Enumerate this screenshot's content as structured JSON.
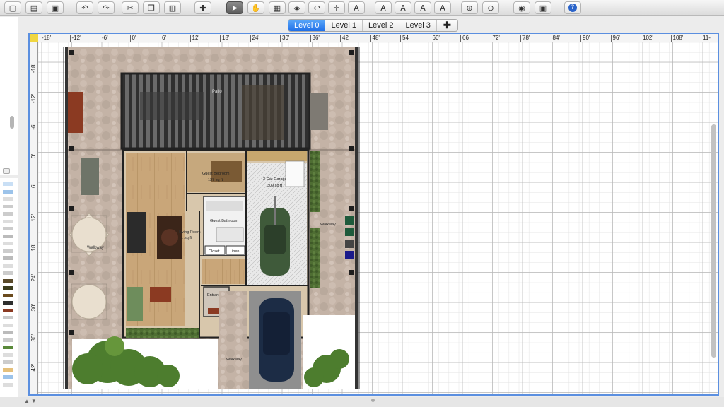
{
  "toolbar": {
    "buttons": [
      {
        "name": "new-home-button",
        "glyph": "▢"
      },
      {
        "name": "open-button",
        "glyph": "▤"
      },
      {
        "name": "save-button",
        "glyph": "▣"
      },
      {
        "name": "undo-button",
        "glyph": "↶"
      },
      {
        "name": "redo-button",
        "glyph": "↷"
      },
      {
        "name": "cut-button",
        "glyph": "✂"
      },
      {
        "name": "copy-button",
        "glyph": "❐"
      },
      {
        "name": "paste-button",
        "glyph": "▥"
      },
      {
        "name": "add-furniture-button",
        "glyph": "✚"
      },
      {
        "name": "select-mode-button",
        "glyph": "➤"
      },
      {
        "name": "pan-mode-button",
        "glyph": "✋"
      },
      {
        "name": "create-walls-button",
        "glyph": "▦"
      },
      {
        "name": "create-rooms-button",
        "glyph": "◈"
      },
      {
        "name": "create-polylines-button",
        "glyph": "↩"
      },
      {
        "name": "create-dimensions-button",
        "glyph": "✛"
      },
      {
        "name": "add-text-button",
        "glyph": "A"
      },
      {
        "name": "increase-text-size-button",
        "glyph": "A"
      },
      {
        "name": "decrease-text-size-button",
        "glyph": "A"
      },
      {
        "name": "bold-text-button",
        "glyph": "A"
      },
      {
        "name": "italic-text-button",
        "glyph": "A"
      },
      {
        "name": "zoom-in-button",
        "glyph": "⊕"
      },
      {
        "name": "zoom-out-button",
        "glyph": "⊖"
      },
      {
        "name": "create-photo-button",
        "glyph": "◉"
      },
      {
        "name": "create-video-button",
        "glyph": "▣"
      },
      {
        "name": "help-button",
        "glyph": "?"
      }
    ]
  },
  "levels": {
    "tabs": [
      "Level 0",
      "Level 1",
      "Level 2",
      "Level 3"
    ],
    "selected": "Level 0",
    "add_label": "✚"
  },
  "ruler": {
    "top": [
      "-18'",
      "-12'",
      "-6'",
      "0'",
      "6'",
      "12'",
      "18'",
      "24'",
      "30'",
      "36'",
      "42'",
      "48'",
      "54'",
      "60'",
      "66'",
      "72'",
      "78'",
      "84'",
      "90'",
      "96'",
      "102'",
      "108'",
      "11-"
    ],
    "left": [
      "-18'",
      "-12'",
      "-6'",
      "0'",
      "6'",
      "12'",
      "18'",
      "24'",
      "30'",
      "36'",
      "42'"
    ]
  },
  "rooms": {
    "patio": "Patio",
    "guest_bedroom": "Guest Bedroom",
    "guest_bedroom_area": "137 sq ft",
    "garage": "3-Car Garage",
    "garage_area": "309 sq ft",
    "guest_bathroom": "Guest Bathroom",
    "living_room": "Living Room",
    "living_room_area": "..sq ft",
    "closet": "Closet",
    "linen": "Linen",
    "entrance": "Entrance",
    "walkway_left": "Walkway",
    "walkway_right": "Walkway",
    "walkway_bottom": "Walkway"
  },
  "colors": {
    "accent": "#2a7bf0",
    "grid": "#c9c9c9",
    "wall": "#333333",
    "stone": "#c8b7a8"
  }
}
